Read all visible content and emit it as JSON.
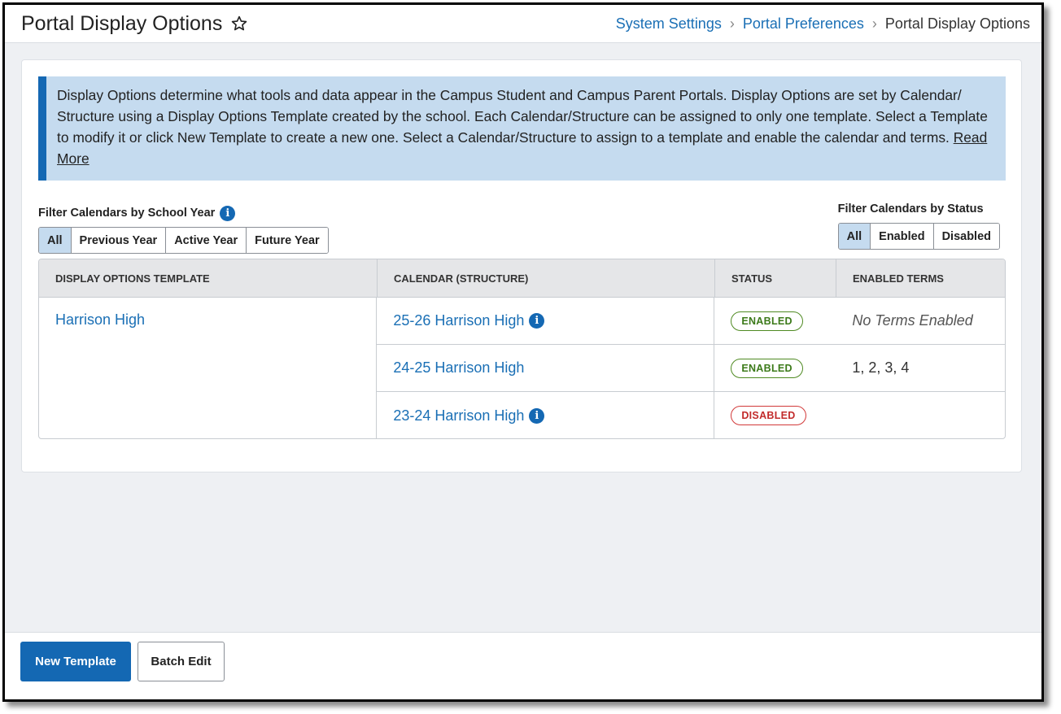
{
  "header": {
    "title": "Portal Display Options",
    "breadcrumb": [
      {
        "label": "System Settings"
      },
      {
        "label": "Portal Preferences"
      },
      {
        "label": "Portal Display Options"
      }
    ]
  },
  "info": {
    "text": "Display Options determine what tools and data appear in the Campus Student and Campus Parent Portals. Display Options are set by Calendar/ Structure using a Display Options Template created by the school. Each Calendar/Structure can be assigned to only one template. Select a Template to modify it or click New Template to create a new one. Select a Calendar/Structure to assign to a template and enable the calendar and terms. ",
    "read_more": "Read More"
  },
  "filters": {
    "year": {
      "label": "Filter Calendars by School Year",
      "options": [
        "All",
        "Previous Year",
        "Active Year",
        "Future Year"
      ],
      "selected": "All"
    },
    "status": {
      "label": "Filter Calendars by Status",
      "options": [
        "All",
        "Enabled",
        "Disabled"
      ],
      "selected": "All"
    }
  },
  "table": {
    "headers": [
      "DISPLAY OPTIONS TEMPLATE",
      "CALENDAR (STRUCTURE)",
      "STATUS",
      "ENABLED TERMS"
    ],
    "template": "Harrison High",
    "rows": [
      {
        "calendar": "25-26 Harrison High",
        "status": "ENABLED",
        "terms": "No Terms Enabled"
      },
      {
        "calendar": "24-25 Harrison High",
        "status": "ENABLED",
        "terms": "1, 2, 3, 4"
      },
      {
        "calendar": "23-24 Harrison High",
        "status": "DISABLED",
        "terms": ""
      }
    ]
  },
  "footer": {
    "new_template": "New Template",
    "batch_edit": "Batch Edit"
  },
  "colors": {
    "accent": "#1468b3",
    "link": "#1a6fb5",
    "info_bg": "#c5dbef",
    "enabled": "#3c7a1a",
    "disabled": "#c22b2b"
  }
}
